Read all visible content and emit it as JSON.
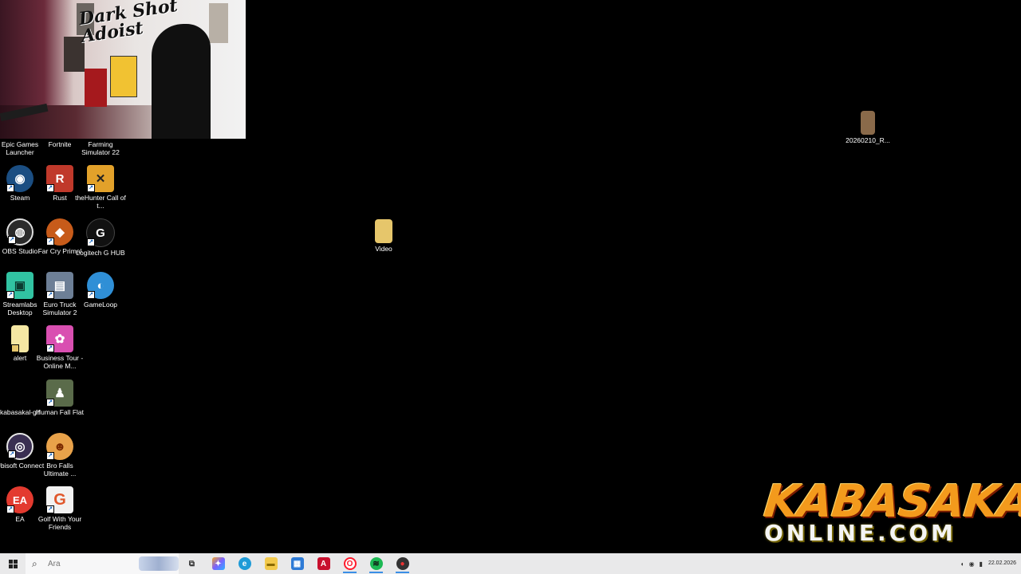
{
  "webcam": {
    "sign_text": "Dark Shot Adoist"
  },
  "desktop_icons": [
    {
      "name": "epic-games-launcher",
      "label": "Epic Games Launcher",
      "color": "#2a2a2a",
      "glyph": ""
    },
    {
      "name": "fortnite",
      "label": "Fortnite",
      "color": "#3a3a3a",
      "glyph": ""
    },
    {
      "name": "farming-simulator-22",
      "label": "Farming Simulator 22",
      "color": "#3a3a3a",
      "glyph": ""
    },
    {
      "name": "steam",
      "label": "Steam",
      "color": "#1b4e82",
      "glyph": "◉"
    },
    {
      "name": "rust",
      "label": "Rust",
      "color": "#c0392b",
      "glyph": "R"
    },
    {
      "name": "thehunter",
      "label": "theHunter Call of t...",
      "color": "#e2a12a",
      "glyph": "✕"
    },
    {
      "name": "obs-studio",
      "label": "OBS Studio",
      "color": "#2b2b2b",
      "glyph": "◍"
    },
    {
      "name": "far-cry-primal",
      "label": "Far Cry Primal",
      "color": "#c75b1a",
      "glyph": "◆"
    },
    {
      "name": "logitech-g-hub",
      "label": "Logitech G HUB",
      "color": "#111111",
      "glyph": "G"
    },
    {
      "name": "streamlabs-desktop",
      "label": "Streamlabs Desktop",
      "color": "#31c3a2",
      "glyph": "▣"
    },
    {
      "name": "euro-truck-simulator-2",
      "label": "Euro Truck Simulator 2",
      "color": "#6d7f96",
      "glyph": "▤"
    },
    {
      "name": "gameloop",
      "label": "GameLoop",
      "color": "#2f8fd6",
      "glyph": "◐"
    },
    {
      "name": "alert",
      "label": "alert",
      "color": "#f5e7a3",
      "glyph": ""
    },
    {
      "name": "business-tour",
      "label": "Business Tour - Online M...",
      "color": "#d94fb1",
      "glyph": "✿"
    },
    {
      "name": "kabasakal-gif",
      "label": "kabasakal-gif",
      "color": "#000000",
      "glyph": ""
    },
    {
      "name": "human-fall-flat",
      "label": "Human Fall Flat",
      "color": "#5a6b4a",
      "glyph": "♟"
    },
    {
      "name": "ubisoft-connect",
      "label": "Ubisoft Connect",
      "color": "#3a2f52",
      "glyph": "◎"
    },
    {
      "name": "bro-falls",
      "label": "Bro Falls Ultimate ...",
      "color": "#e8a24a",
      "glyph": "☻"
    },
    {
      "name": "ea",
      "label": "EA",
      "color": "#e33a2f",
      "glyph": "EA"
    },
    {
      "name": "golf-with-your-friends",
      "label": "Golf With Your Friends",
      "color": "#f2f2f2",
      "glyph": "G"
    },
    {
      "name": "video-folder",
      "label": "Video",
      "color": "#e6c66b",
      "glyph": ""
    },
    {
      "name": "recording-file",
      "label": "20260210_R...",
      "color": "#8a6a4a",
      "glyph": ""
    }
  ],
  "logo": {
    "line1": "KABASAKAL",
    "line2": "ONLINE.COM"
  },
  "taskbar": {
    "search_placeholder": "Ara",
    "apps": [
      {
        "name": "task-view",
        "glyph": "⧉",
        "color": "#e9e9ea",
        "text_color": "#333"
      },
      {
        "name": "copilot",
        "glyph": "✦",
        "color": "#7b61ff",
        "text_color": "#fff"
      },
      {
        "name": "edge",
        "glyph": "e",
        "color": "#1f9bd7",
        "text_color": "#fff"
      },
      {
        "name": "file-explorer",
        "glyph": "▬",
        "color": "#f2c94c",
        "text_color": "#8a6a00"
      },
      {
        "name": "microsoft-store",
        "glyph": "▦",
        "color": "#2e7bd6",
        "text_color": "#fff"
      },
      {
        "name": "adobe-app",
        "glyph": "A",
        "color": "#c8102e",
        "text_color": "#fff"
      },
      {
        "name": "opera",
        "glyph": "O",
        "color": "#ff1b2d",
        "text_color": "#fff"
      },
      {
        "name": "spotify",
        "glyph": "≋",
        "color": "#1db954",
        "text_color": "#111"
      },
      {
        "name": "obs-taskbar",
        "glyph": "●",
        "color": "#333333",
        "text_color": "#e33"
      }
    ],
    "tray_icons": [
      "speaker",
      "network",
      "battery"
    ],
    "clock_date": "22.02.2026"
  }
}
